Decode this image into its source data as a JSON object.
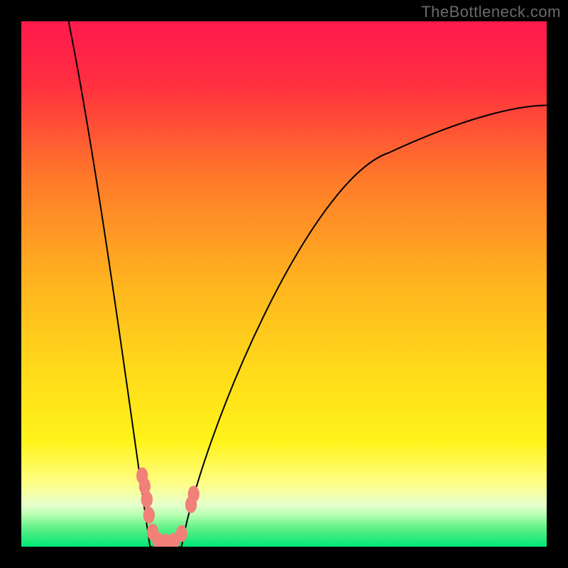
{
  "watermark": "TheBottleneck.com",
  "chart_data": {
    "type": "line",
    "title": "",
    "xlabel": "",
    "ylabel": "",
    "xlim": [
      0,
      100
    ],
    "ylim": [
      0,
      100
    ],
    "background": {
      "type": "vertical-gradient",
      "stops": [
        {
          "pos": 0.0,
          "color": "#ff1a4d"
        },
        {
          "pos": 0.12,
          "color": "#ff2f3f"
        },
        {
          "pos": 0.3,
          "color": "#ff7a2a"
        },
        {
          "pos": 0.5,
          "color": "#ffb41f"
        },
        {
          "pos": 0.66,
          "color": "#ffd91a"
        },
        {
          "pos": 0.8,
          "color": "#fff31a"
        },
        {
          "pos": 0.88,
          "color": "#ffff88"
        },
        {
          "pos": 0.92,
          "color": "#e6ffcc"
        },
        {
          "pos": 0.94,
          "color": "#b6ffb0"
        },
        {
          "pos": 0.96,
          "color": "#6cf28a"
        },
        {
          "pos": 1.0,
          "color": "#00e676"
        }
      ]
    },
    "curve": {
      "description": "Asymmetric V-shaped bottleneck curve",
      "min_x": 27,
      "min_y": 0,
      "left_branch_start": {
        "x": 9,
        "y": 100
      },
      "right_branch_end": {
        "x": 100,
        "y": 84
      },
      "bottom_flat_range_x": [
        24.5,
        30.5
      ]
    },
    "markers": {
      "color": "#f08078",
      "cluster_description": "Pink lozenge markers clustered near the curve minimum",
      "points": [
        {
          "x": 23.0,
          "y": 13.5
        },
        {
          "x": 23.5,
          "y": 11.5
        },
        {
          "x": 23.9,
          "y": 9.0
        },
        {
          "x": 24.3,
          "y": 6.0
        },
        {
          "x": 25.0,
          "y": 2.8
        },
        {
          "x": 26.0,
          "y": 1.2
        },
        {
          "x": 27.5,
          "y": 0.9
        },
        {
          "x": 29.0,
          "y": 1.0
        },
        {
          "x": 30.5,
          "y": 2.5
        },
        {
          "x": 32.3,
          "y": 8.0
        },
        {
          "x": 32.8,
          "y": 10.0
        }
      ]
    }
  }
}
